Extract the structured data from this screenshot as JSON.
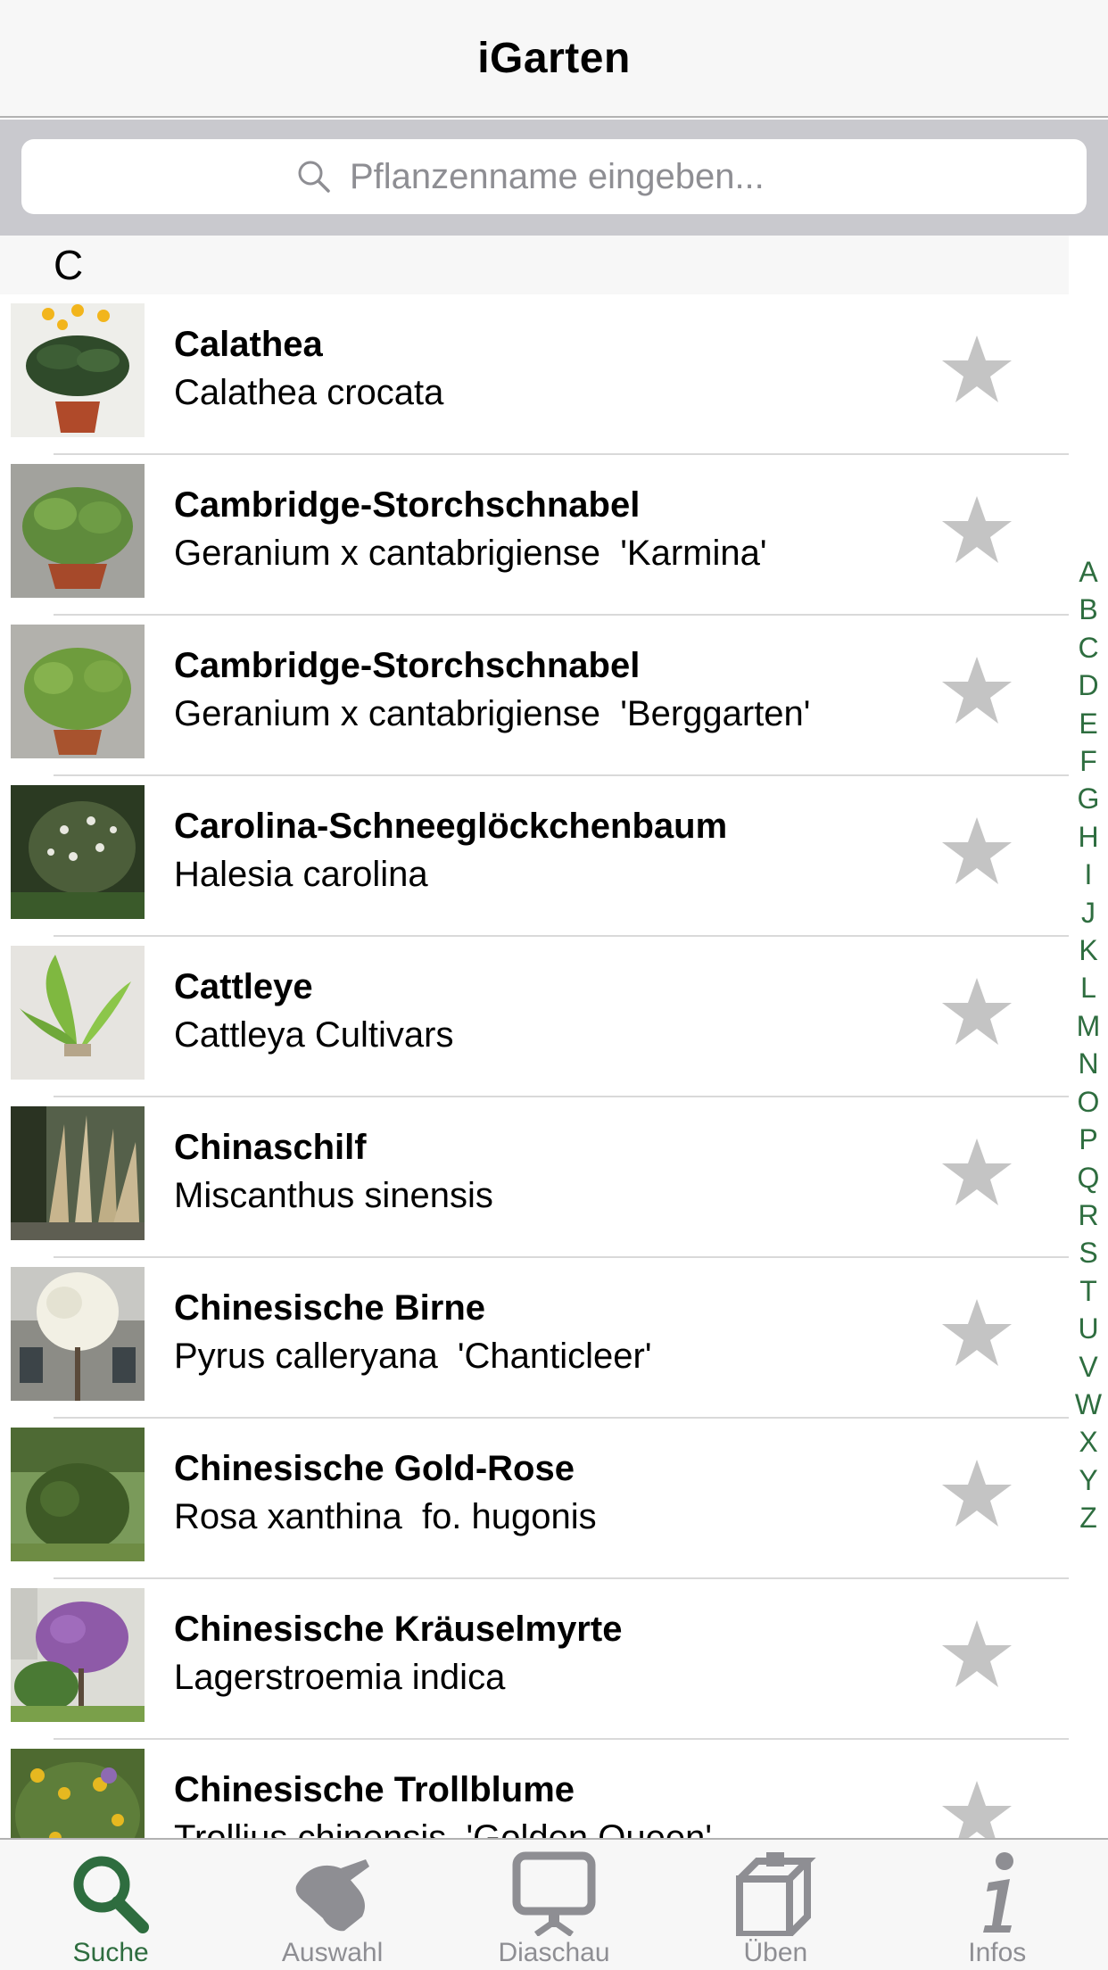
{
  "navbar": {
    "title": "iGarten"
  },
  "search": {
    "placeholder": "Pflanzenname eingeben..."
  },
  "list": {
    "section": "C",
    "rows": [
      {
        "name": "Calathea",
        "latin": "Calathea crocata",
        "thumb": "potted-plant-yellow-flowers"
      },
      {
        "name": "Cambridge-Storchschnabel",
        "latin": "Geranium x cantabrigiense  'Karmina'",
        "thumb": "potted-geranium"
      },
      {
        "name": "Cambridge-Storchschnabel",
        "latin": "Geranium x cantabrigiense  'Berggarten'",
        "thumb": "potted-geranium"
      },
      {
        "name": "Carolina-Schneeglöckchenbaum",
        "latin": "Halesia carolina",
        "thumb": "flowering-tree"
      },
      {
        "name": "Cattleye",
        "latin": "Cattleya Cultivars",
        "thumb": "orchid"
      },
      {
        "name": "Chinaschilf",
        "latin": "Miscanthus sinensis",
        "thumb": "ornamental-grass"
      },
      {
        "name": "Chinesische Birne",
        "latin": "Pyrus calleryana  'Chanticleer'",
        "thumb": "pear-tree-building"
      },
      {
        "name": "Chinesische Gold-Rose",
        "latin": "Rosa xanthina  fo. hugonis",
        "thumb": "shrub"
      },
      {
        "name": "Chinesische Kräuselmyrte",
        "latin": "Lagerstroemia indica",
        "thumb": "purple-flowering-tree"
      },
      {
        "name": "Chinesische Trollblume",
        "latin": "Trollius chinensis  'Golden Queen'",
        "thumb": "yellow-flowers-bed"
      }
    ]
  },
  "index": [
    "A",
    "B",
    "C",
    "D",
    "E",
    "F",
    "G",
    "H",
    "I",
    "J",
    "K",
    "L",
    "M",
    "N",
    "O",
    "P",
    "Q",
    "R",
    "S",
    "T",
    "U",
    "V",
    "W",
    "X",
    "Y",
    "Z"
  ],
  "tabs": [
    {
      "label": "Suche",
      "icon": "search-icon",
      "active": true
    },
    {
      "label": "Auswahl",
      "icon": "hand-icon",
      "active": false
    },
    {
      "label": "Diaschau",
      "icon": "slideshow-screen-icon",
      "active": false
    },
    {
      "label": "Üben",
      "icon": "flashcards-icon",
      "active": false
    },
    {
      "label": "Infos",
      "icon": "info-icon",
      "active": false
    }
  ],
  "colors": {
    "accent": "#2e6d3f",
    "inactive": "#8e8e93",
    "star": "#c4c4c4"
  }
}
